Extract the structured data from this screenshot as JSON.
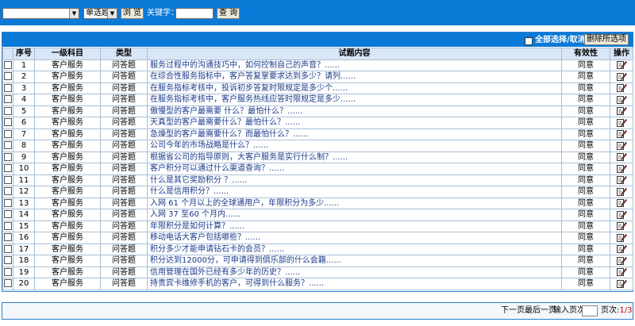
{
  "search": {
    "category_value": "",
    "type_value": "单选题",
    "browse_label": "浏 览",
    "keyword_label": "关键字：",
    "keyword_value": "",
    "query_label": "查 询"
  },
  "toolbar": {
    "select_all_label": "全部选择/取消",
    "delete_label": "删除所选项"
  },
  "table": {
    "headers": {
      "index": "序号",
      "subject": "一级科目",
      "type": "类型",
      "content": "试题内容",
      "validity": "有效性",
      "action": "操作"
    },
    "rows": [
      {
        "index": "1",
        "subject": "客户服务",
        "type": "问答题",
        "content": "服务过程中的沟通技巧中，如何控制自己的声音？......",
        "validity": "同意"
      },
      {
        "index": "2",
        "subject": "客户服务",
        "type": "问答题",
        "content": "在综合性服务指标中，客户答复掌要求达到多少？请列......",
        "validity": "同意"
      },
      {
        "index": "3",
        "subject": "客户服务",
        "type": "问答题",
        "content": "在服务指标考核中，投诉初步答复时限规定是多少个......",
        "validity": "同意"
      },
      {
        "index": "4",
        "subject": "客户服务",
        "type": "问答题",
        "content": "在服务指标考核中，客户服务热线应答时限规定是多少......",
        "validity": "同意"
      },
      {
        "index": "5",
        "subject": "客户服务",
        "type": "问答题",
        "content": "傲慢型的客户最需要 什么？最怕什么？......",
        "validity": "同意"
      },
      {
        "index": "6",
        "subject": "客户服务",
        "type": "问答题",
        "content": "天真型的客户最需要什么？最怕什么？......",
        "validity": "同意"
      },
      {
        "index": "7",
        "subject": "客户服务",
        "type": "问答题",
        "content": "急燥型的客户最需要什么？而最怕什么？......",
        "validity": "同意"
      },
      {
        "index": "8",
        "subject": "客户服务",
        "type": "问答题",
        "content": "公司今年的市场战略是什么？......",
        "validity": "同意"
      },
      {
        "index": "9",
        "subject": "客户服务",
        "type": "问答题",
        "content": "根据省公司的指导原则，大客户服务是实行什么制？......",
        "validity": "同意"
      },
      {
        "index": "10",
        "subject": "客户服务",
        "type": "问答题",
        "content": "客户积分可以通过什么渠道查询？......",
        "validity": "同意"
      },
      {
        "index": "11",
        "subject": "客户服务",
        "type": "问答题",
        "content": "什么是其它奖励积分 ？......",
        "validity": "同意"
      },
      {
        "index": "12",
        "subject": "客户服务",
        "type": "问答题",
        "content": "什么是信用积分？......",
        "validity": "同意"
      },
      {
        "index": "13",
        "subject": "客户服务",
        "type": "问答题",
        "content": "入网 61 个月以上的全球通用户，年限积分为多少......",
        "validity": "同意"
      },
      {
        "index": "14",
        "subject": "客户服务",
        "type": "问答题",
        "content": "入网 37  至60 个月内......",
        "validity": "同意"
      },
      {
        "index": "15",
        "subject": "客户服务",
        "type": "问答题",
        "content": "年限积分是如何计算？......",
        "validity": "同意"
      },
      {
        "index": "16",
        "subject": "客户服务",
        "type": "问答题",
        "content": "移动电话大客户包括哪些？......",
        "validity": "同意"
      },
      {
        "index": "17",
        "subject": "客户服务",
        "type": "问答题",
        "content": "积分多少才能申请钻石卡的会员？......",
        "validity": "同意"
      },
      {
        "index": "18",
        "subject": "客户服务",
        "type": "问答题",
        "content": "积分达到12000分，可申请得到俱乐部的什么会籍......",
        "validity": "同意"
      },
      {
        "index": "19",
        "subject": "客户服务",
        "type": "问答题",
        "content": "信用管理在国外已经有多少年的历史？......",
        "validity": "同意"
      },
      {
        "index": "20",
        "subject": "客户服务",
        "type": "问答题",
        "content": "持贵宾卡维修手机的客户，可得到什么服务？......",
        "validity": "同意"
      }
    ]
  },
  "pagination": {
    "next_label": "下一页",
    "last_label": "最后一页",
    "goto_label": "输入页次:",
    "goto_value": "",
    "page_label": "页次:",
    "page_value": "1/3"
  },
  "colors": {
    "header_blue": "#0a7ad6",
    "border_blue": "#2d7fc9",
    "link_text": "#1a3a8a",
    "page_value": "#cc0000"
  },
  "icons": {
    "row_action": "edit-icon"
  }
}
